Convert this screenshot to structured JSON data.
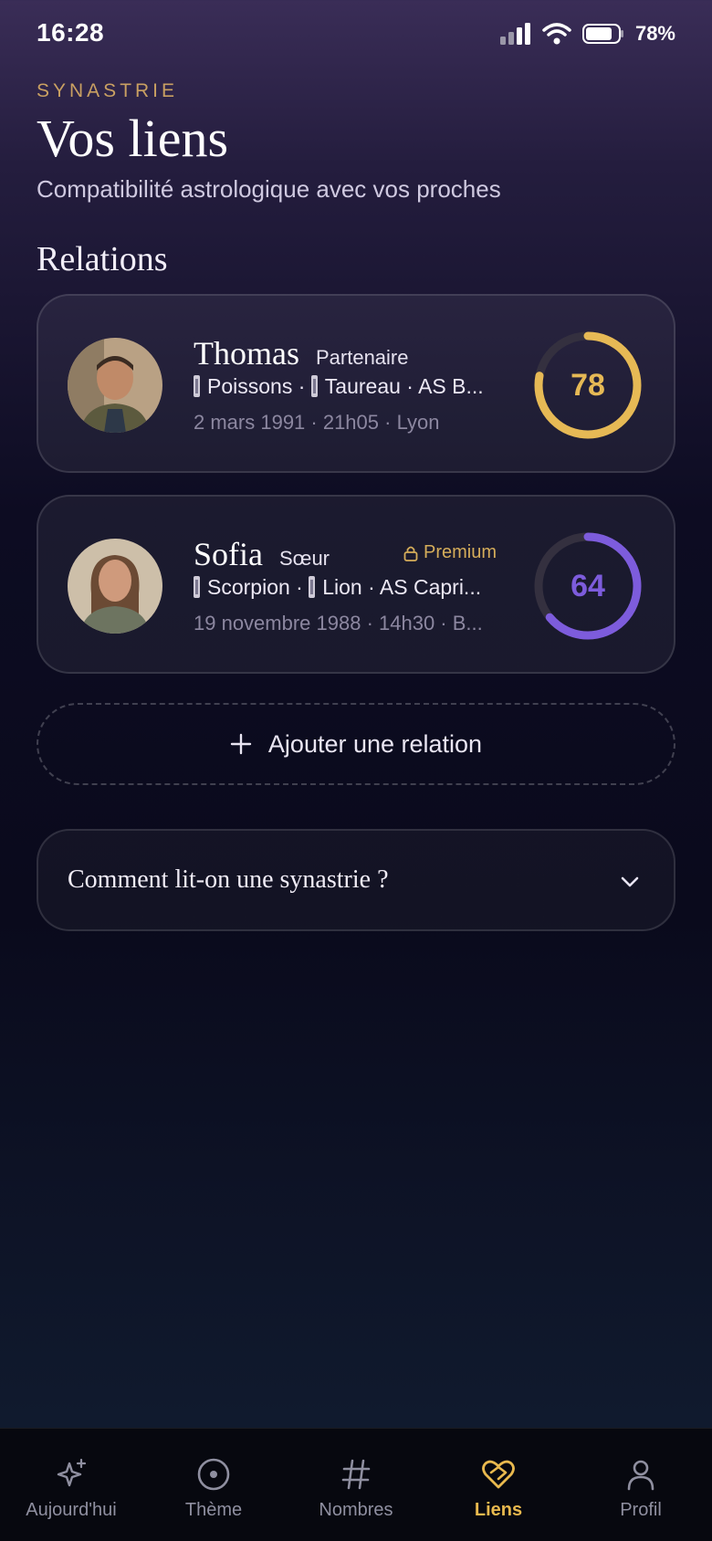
{
  "status_bar": {
    "time": "16:28",
    "battery": "78%"
  },
  "header": {
    "eyebrow": "SYNASTRIE",
    "title": "Vos liens",
    "subtitle": "Compatibilité astrologique avec vos proches"
  },
  "section_title": "Relations",
  "relations": [
    {
      "name": "Thomas",
      "relation": "Partenaire",
      "sun": "Poissons",
      "moon": "Taureau",
      "ascendant": "AS B...",
      "birth": "2 mars 1991 · 21h05 · Lyon",
      "score": "78",
      "score_value": 78,
      "score_color": "#e6b955",
      "premium": ""
    },
    {
      "name": "Sofia",
      "relation": "Sœur",
      "sun": "Scorpion",
      "moon": "Lion",
      "ascendant": "AS Capri...",
      "birth": "19 novembre 1988 · 14h30 · B...",
      "score": "64",
      "score_value": 64,
      "score_color": "#7d5cdc",
      "premium": "Premium"
    }
  ],
  "add_relation_label": "Ajouter une relation",
  "faq_label": "Comment lit-on une synastrie ?",
  "tabs": [
    {
      "label": "Aujourd'hui",
      "icon": "sparkle-icon"
    },
    {
      "label": "Thème",
      "icon": "chart-wheel-icon"
    },
    {
      "label": "Nombres",
      "icon": "hash-icon"
    },
    {
      "label": "Liens",
      "icon": "heart-link-icon",
      "active": true
    },
    {
      "label": "Profil",
      "icon": "user-icon"
    }
  ],
  "colors": {
    "accent": "#e9b94e",
    "purple": "#7d5cdc",
    "eyebrow": "#c9a062"
  }
}
